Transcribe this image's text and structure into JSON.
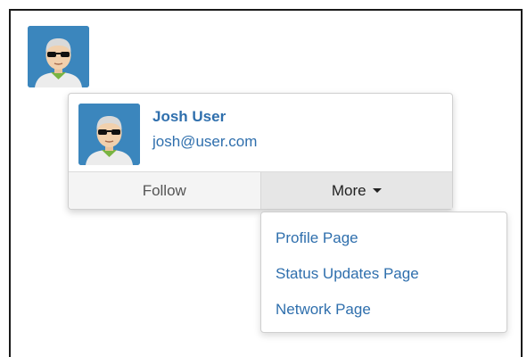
{
  "user": {
    "name": "Josh User",
    "email": "josh@user.com"
  },
  "actions": {
    "follow_label": "Follow",
    "more_label": "More"
  },
  "more_menu": {
    "items": [
      {
        "label": "Profile Page"
      },
      {
        "label": "Status Updates Page"
      },
      {
        "label": "Network Page"
      }
    ]
  },
  "icons": {
    "avatar": "user-avatar-icon",
    "caret": "caret-down-icon"
  },
  "colors": {
    "link": "#2f6fad",
    "avatar_bg": "#3b86bd",
    "shirt": "#79b442"
  }
}
